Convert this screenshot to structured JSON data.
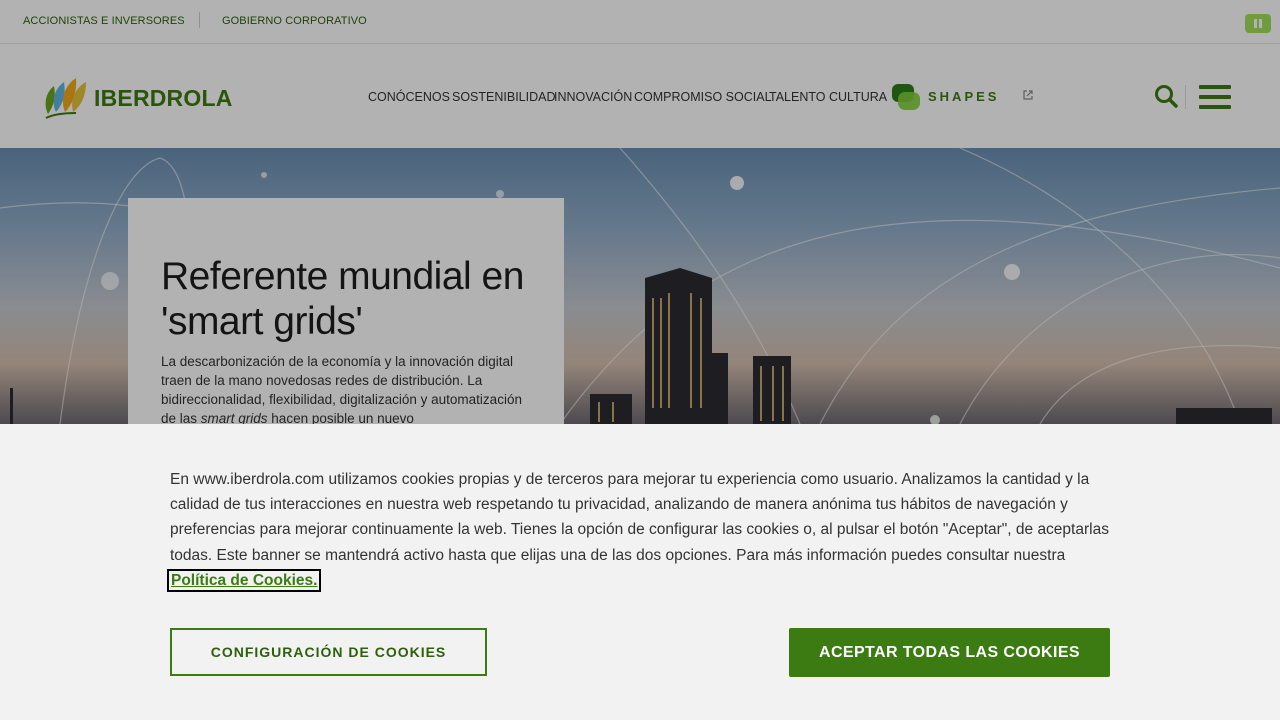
{
  "topbar": {
    "links": [
      "ACCIONISTAS E INVERSORES",
      "GOBIERNO CORPORATIVO"
    ],
    "pause_icon": "pause-icon"
  },
  "header": {
    "logo_text": "IBERDROLA",
    "nav": [
      "CONÓCENOS",
      "SOSTENIBILIDAD",
      "INNOVACIÓN",
      "COMPROMISO SOCIAL",
      "TALENTO",
      "CULTURA"
    ],
    "shapes_label": "SHAPES",
    "icons": [
      "search-icon",
      "menu-icon",
      "external-link-icon"
    ]
  },
  "hero": {
    "title": "Referente mundial en 'smart grids'",
    "text_before": "La descarbonización de la economía y la innovación digital traen de la mano novedosas redes de distribución. La bidireccionalidad, flexibilidad, digitalización y automatización de las ",
    "text_em": "smart grids",
    "text_after": " hacen posible un nuevo"
  },
  "cookie": {
    "text": "En www.iberdrola.com utilizamos cookies propias y de terceros para mejorar tu experiencia como usuario. Analizamos la cantidad y la calidad de tus interacciones en nuestra web respetando tu privacidad, analizando de manera anónima tus hábitos de navegación y preferencias para mejorar continuamente la web. Tienes la opción de configurar las cookies o, al pulsar el botón \"Aceptar\", de aceptarlas todas. Este banner se mantendrá activo hasta que elijas una de las dos opciones. Para más información puedes consultar nuestra ",
    "link_label": "Política de Cookies.",
    "config_button": "CONFIGURACIÓN DE COOKIES",
    "accept_button": "ACEPTAR TODAS LAS COOKIES"
  },
  "colors": {
    "brand_green": "#3c7a12",
    "dark_green": "#2d5f0c",
    "banner_bg": "#f2f2f2"
  }
}
